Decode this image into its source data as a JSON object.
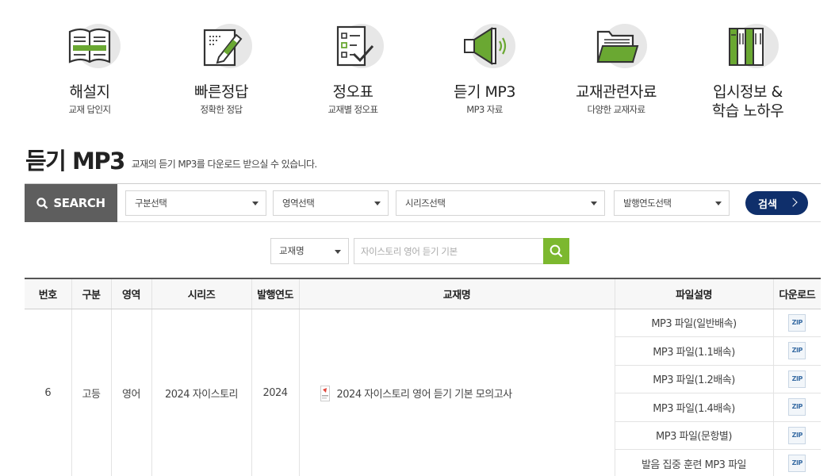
{
  "categories": [
    {
      "title": "해설지",
      "sub": "교재 답인지",
      "icon": "book-open-icon"
    },
    {
      "title": "빠른정답",
      "sub": "정확한 정답",
      "icon": "answer-pen-icon"
    },
    {
      "title": "정오표",
      "sub": "교재별 정오표",
      "icon": "checklist-icon"
    },
    {
      "title": "듣기 MP3",
      "sub": "MP3 자료",
      "icon": "speaker-icon"
    },
    {
      "title": "교재관련자료",
      "sub": "다양한 교재자료",
      "icon": "folder-icon"
    },
    {
      "title": "입시정보 &\n학습 노하우",
      "sub": "",
      "icon": "books-icon"
    }
  ],
  "page": {
    "title": "듣기 MP3",
    "description": "교재의 듣기 MP3를 다운로드 받으실 수 있습니다."
  },
  "search": {
    "label": "SEARCH",
    "selects": [
      "구분선택",
      "영역선택",
      "시리즈선택",
      "발행연도선택"
    ],
    "button": "검색",
    "book_select": "교재명",
    "book_placeholder": "자이스토리 영어 듣기 기본"
  },
  "table": {
    "headers": [
      "번호",
      "구분",
      "영역",
      "시리즈",
      "발행연도",
      "교재명",
      "파일설명",
      "다운로드"
    ],
    "row": {
      "no": "6",
      "level": "고등",
      "subject": "영어",
      "series": "2024 자이스토리",
      "year": "2024",
      "book": "2024 자이스토리 영어 듣기 기본 모의고사",
      "files": [
        "MP3 파일(일반배속)",
        "MP3 파일(1.1배속)",
        "MP3 파일(1.2배속)",
        "MP3 파일(1.4배속)",
        "MP3 파일(문항별)",
        "발음 집중 훈련 MP3 파일"
      ],
      "download_label": "ZIP"
    }
  },
  "colors": {
    "accent_green": "#7cb82f",
    "navy": "#0f2f6b",
    "search_gray": "#5e5e5e"
  }
}
